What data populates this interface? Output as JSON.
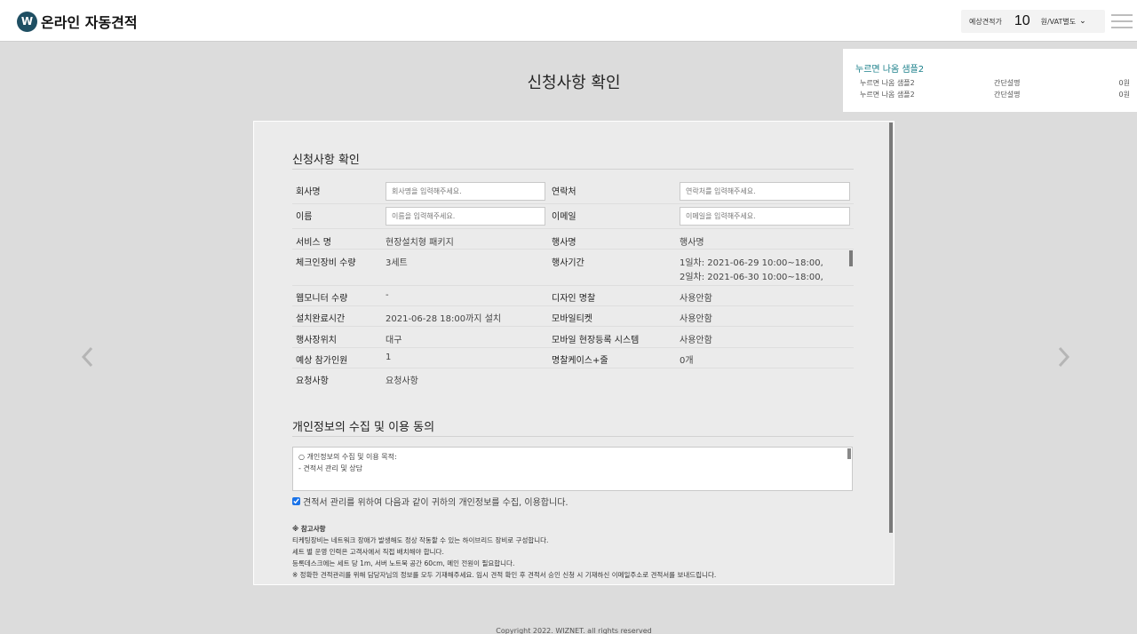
{
  "header": {
    "logo_mark": "W",
    "logo_text": "온라인 자동견적",
    "estimate_label": "예상견적가",
    "estimate_value": "10",
    "estimate_unit": "원/VAT별도"
  },
  "popup": {
    "title": "누르면 나옴 샘플2",
    "rows": [
      {
        "name": "누르면 나옴 샘플2",
        "desc": "간단설명",
        "price": "0원"
      },
      {
        "name": "누르면 나옴 샘플2",
        "desc": "간단설명",
        "price": "0원"
      }
    ]
  },
  "page_title": "신청사항 확인",
  "card": {
    "section1_title": "신청사항 확인",
    "fields": {
      "company_label": "회사명",
      "company_placeholder": "회사명을 입력해주세요.",
      "contact_label": "연락처",
      "contact_placeholder": "연락처를 입력해주세요.",
      "name_label": "이름",
      "name_placeholder": "이름을 입력해주세요.",
      "email_label": "이메일",
      "email_placeholder": "이메일을 입력해주세요."
    },
    "info": {
      "service_label": "서비스 명",
      "service_value": "현장설치형 패키지",
      "event_label": "행사명",
      "event_value": "행사명",
      "checkin_label": "체크인장비 수량",
      "checkin_value": "3세트",
      "period_label": "행사기간",
      "period_line1": "1일차: 2021-06-29 10:00~18:00,",
      "period_line2": "2일차: 2021-06-30 10:00~18:00,",
      "webmonitor_label": "웹모니터 수량",
      "webmonitor_value": "-",
      "design_label": "디자인 명찰",
      "design_value": "사용안함",
      "install_label": "설치완료시간",
      "install_value": "2021-06-28 18:00까지 설치",
      "mobile_ticket_label": "모바일티켓",
      "mobile_ticket_value": "사용안함",
      "location_label": "행사장위치",
      "location_value": "대구",
      "mobile_reg_label": "모바일 현장등록 시스템",
      "mobile_reg_value": "사용안함",
      "attendees_label": "예상 참가인원",
      "attendees_value": "1",
      "badge_case_label": "명찰케이스+줄",
      "badge_case_value": "0개",
      "request_label": "요청사항",
      "request_value": "요청사항"
    },
    "section2_title": "개인정보의 수집 및 이용 동의",
    "privacy_line1": "○ 개인정보의 수집 및 이용 목적:",
    "privacy_line2": "- 견적서 관리 및 상담",
    "agree_text": "견적서 관리를 위하여 다음과 같이 귀하의 개인정보를 수집, 이용합니다.",
    "notes": [
      "※ 참고사항",
      "티케팅장비는 네트워크 장애가 발생해도 정상 작동할 수 있는 하이브리드 장비로 구성합니다.",
      "세트 별 운영 인력은 고객사에서 직접 배치해야 합니다.",
      "등록데스크에는 세트 당 1m, 서버 노트북 공간 60cm, 메인 전원이 필요합니다.",
      "※ 정확한 견적관리를 위해 담당자님의 정보를 모두 기재해주세요. 임시 견적 확인 후 견적서 승인 신청 시 기재하신 이메일주소로 견적서를 보내드립니다."
    ]
  },
  "footer_text": "Copyright 2022. WIZNET. all rights reserved"
}
